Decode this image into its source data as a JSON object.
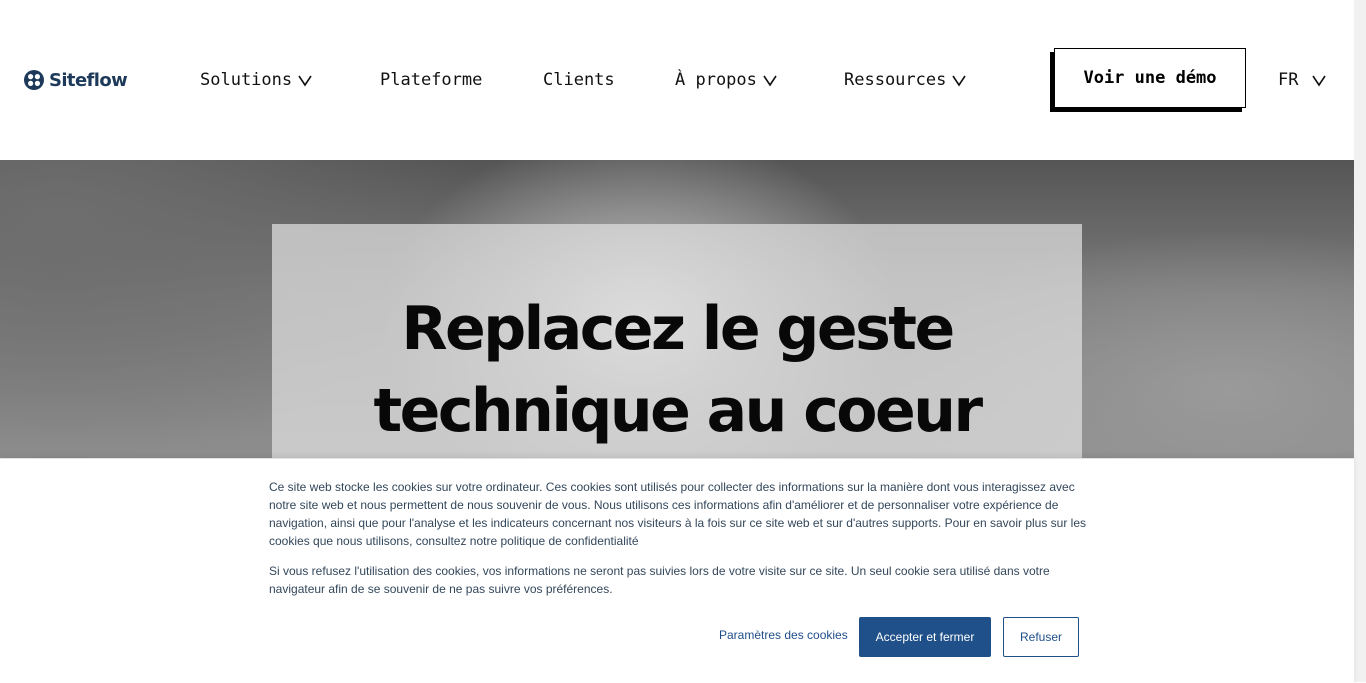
{
  "header": {
    "brand": "Siteflow",
    "logo_icon": "siteflow-logo-icon",
    "nav": [
      {
        "label": "Solutions",
        "dropdown": true
      },
      {
        "label": "Plateforme",
        "dropdown": false
      },
      {
        "label": "Clients",
        "dropdown": false
      },
      {
        "label": "À propos",
        "dropdown": true
      },
      {
        "label": "Ressources",
        "dropdown": true
      }
    ],
    "cta_label": "Voir une démo",
    "language": "FR"
  },
  "hero": {
    "title_line1": "Replacez le geste",
    "title_line2": "technique au coeur"
  },
  "cookie_banner": {
    "paragraph1": "Ce site web stocke les cookies sur votre ordinateur. Ces cookies sont utilisés pour collecter des informations sur la manière dont vous interagissez avec notre site web et nous permettent de nous souvenir de vous. Nous utilisons ces informations afin d'améliorer et de personnaliser votre expérience de navigation, ainsi que pour l'analyse et les indicateurs concernant nos visiteurs à la fois sur ce site web et sur d'autres supports. Pour en savoir plus sur les cookies que nous utilisons, consultez notre politique de confidentialité",
    "paragraph2": "Si vous refusez l'utilisation des cookies, vos informations ne seront pas suivies lors de votre visite sur ce site. Un seul cookie sera utilisé dans votre navigateur afin de se souvenir de ne pas suivre vos préférences.",
    "settings_label": "Paramètres des cookies",
    "accept_label": "Accepter et fermer",
    "refuse_label": "Refuser"
  },
  "colors": {
    "brand": "#1d3a5a",
    "accept_button": "#1f5089",
    "cookie_text": "#33475b"
  }
}
